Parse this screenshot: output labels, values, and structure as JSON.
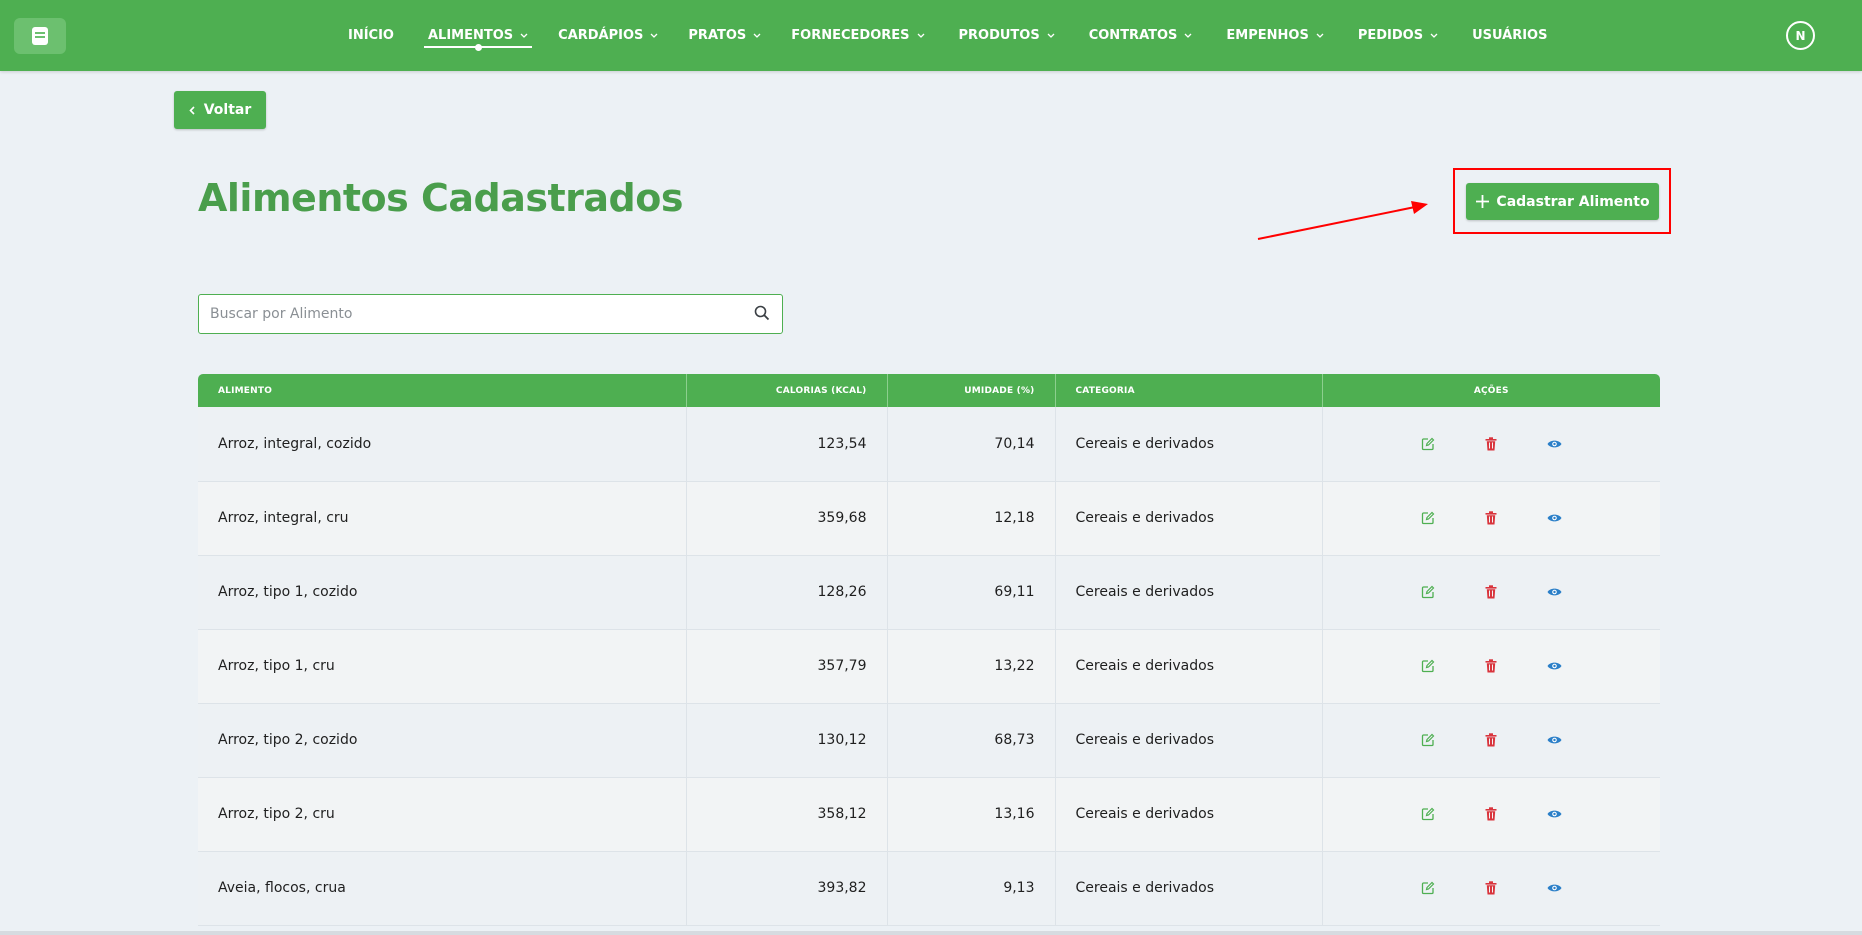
{
  "nav": {
    "items": [
      {
        "label": "INÍCIO",
        "has_dropdown": false,
        "active": false
      },
      {
        "label": "ALIMENTOS",
        "has_dropdown": true,
        "active": true
      },
      {
        "label": "CARDÁPIOS",
        "has_dropdown": true,
        "active": false
      },
      {
        "label": "PRATOS",
        "has_dropdown": true,
        "active": false
      },
      {
        "label": "FORNECEDORES",
        "has_dropdown": true,
        "active": false
      },
      {
        "label": "PRODUTOS",
        "has_dropdown": true,
        "active": false
      },
      {
        "label": "CONTRATOS",
        "has_dropdown": true,
        "active": false
      },
      {
        "label": "EMPENHOS",
        "has_dropdown": true,
        "active": false
      },
      {
        "label": "PEDIDOS",
        "has_dropdown": true,
        "active": false
      },
      {
        "label": "USUÁRIOS",
        "has_dropdown": false,
        "active": false
      }
    ],
    "avatar_initial": "N"
  },
  "back_button": {
    "label": "Voltar"
  },
  "page_title": "Alimentos Cadastrados",
  "add_button": {
    "label": "Cadastrar Alimento"
  },
  "search": {
    "placeholder": "Buscar por Alimento",
    "value": ""
  },
  "table": {
    "headers": {
      "food": "ALIMENTO",
      "kcal": "CALORIAS (KCAL)",
      "humidity": "UMIDADE (%)",
      "category": "CATEGORIA",
      "actions": "AÇÕES"
    },
    "rows": [
      {
        "food": "Arroz, integral, cozido",
        "kcal": "123,54",
        "humidity": "70,14",
        "category": "Cereais e derivados"
      },
      {
        "food": "Arroz, integral, cru",
        "kcal": "359,68",
        "humidity": "12,18",
        "category": "Cereais e derivados"
      },
      {
        "food": "Arroz, tipo 1, cozido",
        "kcal": "128,26",
        "humidity": "69,11",
        "category": "Cereais e derivados"
      },
      {
        "food": "Arroz, tipo 1, cru",
        "kcal": "357,79",
        "humidity": "13,22",
        "category": "Cereais e derivados"
      },
      {
        "food": "Arroz, tipo 2, cozido",
        "kcal": "130,12",
        "humidity": "68,73",
        "category": "Cereais e derivados"
      },
      {
        "food": "Arroz, tipo 2, cru",
        "kcal": "358,12",
        "humidity": "13,16",
        "category": "Cereais e derivados"
      },
      {
        "food": "Aveia, flocos, crua",
        "kcal": "393,82",
        "humidity": "9,13",
        "category": "Cereais e derivados"
      }
    ]
  },
  "icons": {
    "logo": "book-icon",
    "dropdown": "chevron-down-icon",
    "back": "chevron-left-icon",
    "add": "plus-icon",
    "search": "search-icon",
    "edit": "edit-icon",
    "delete": "trash-icon",
    "view": "eye-icon"
  },
  "colors": {
    "brand_green": "#4eaf51",
    "title_green": "#4a9e4c",
    "background": "#ecf1f5",
    "edit_icon": "#4eaf51",
    "delete_icon": "#d9343c",
    "view_icon": "#2b7fc8",
    "annotation_red": "#ff0000"
  }
}
